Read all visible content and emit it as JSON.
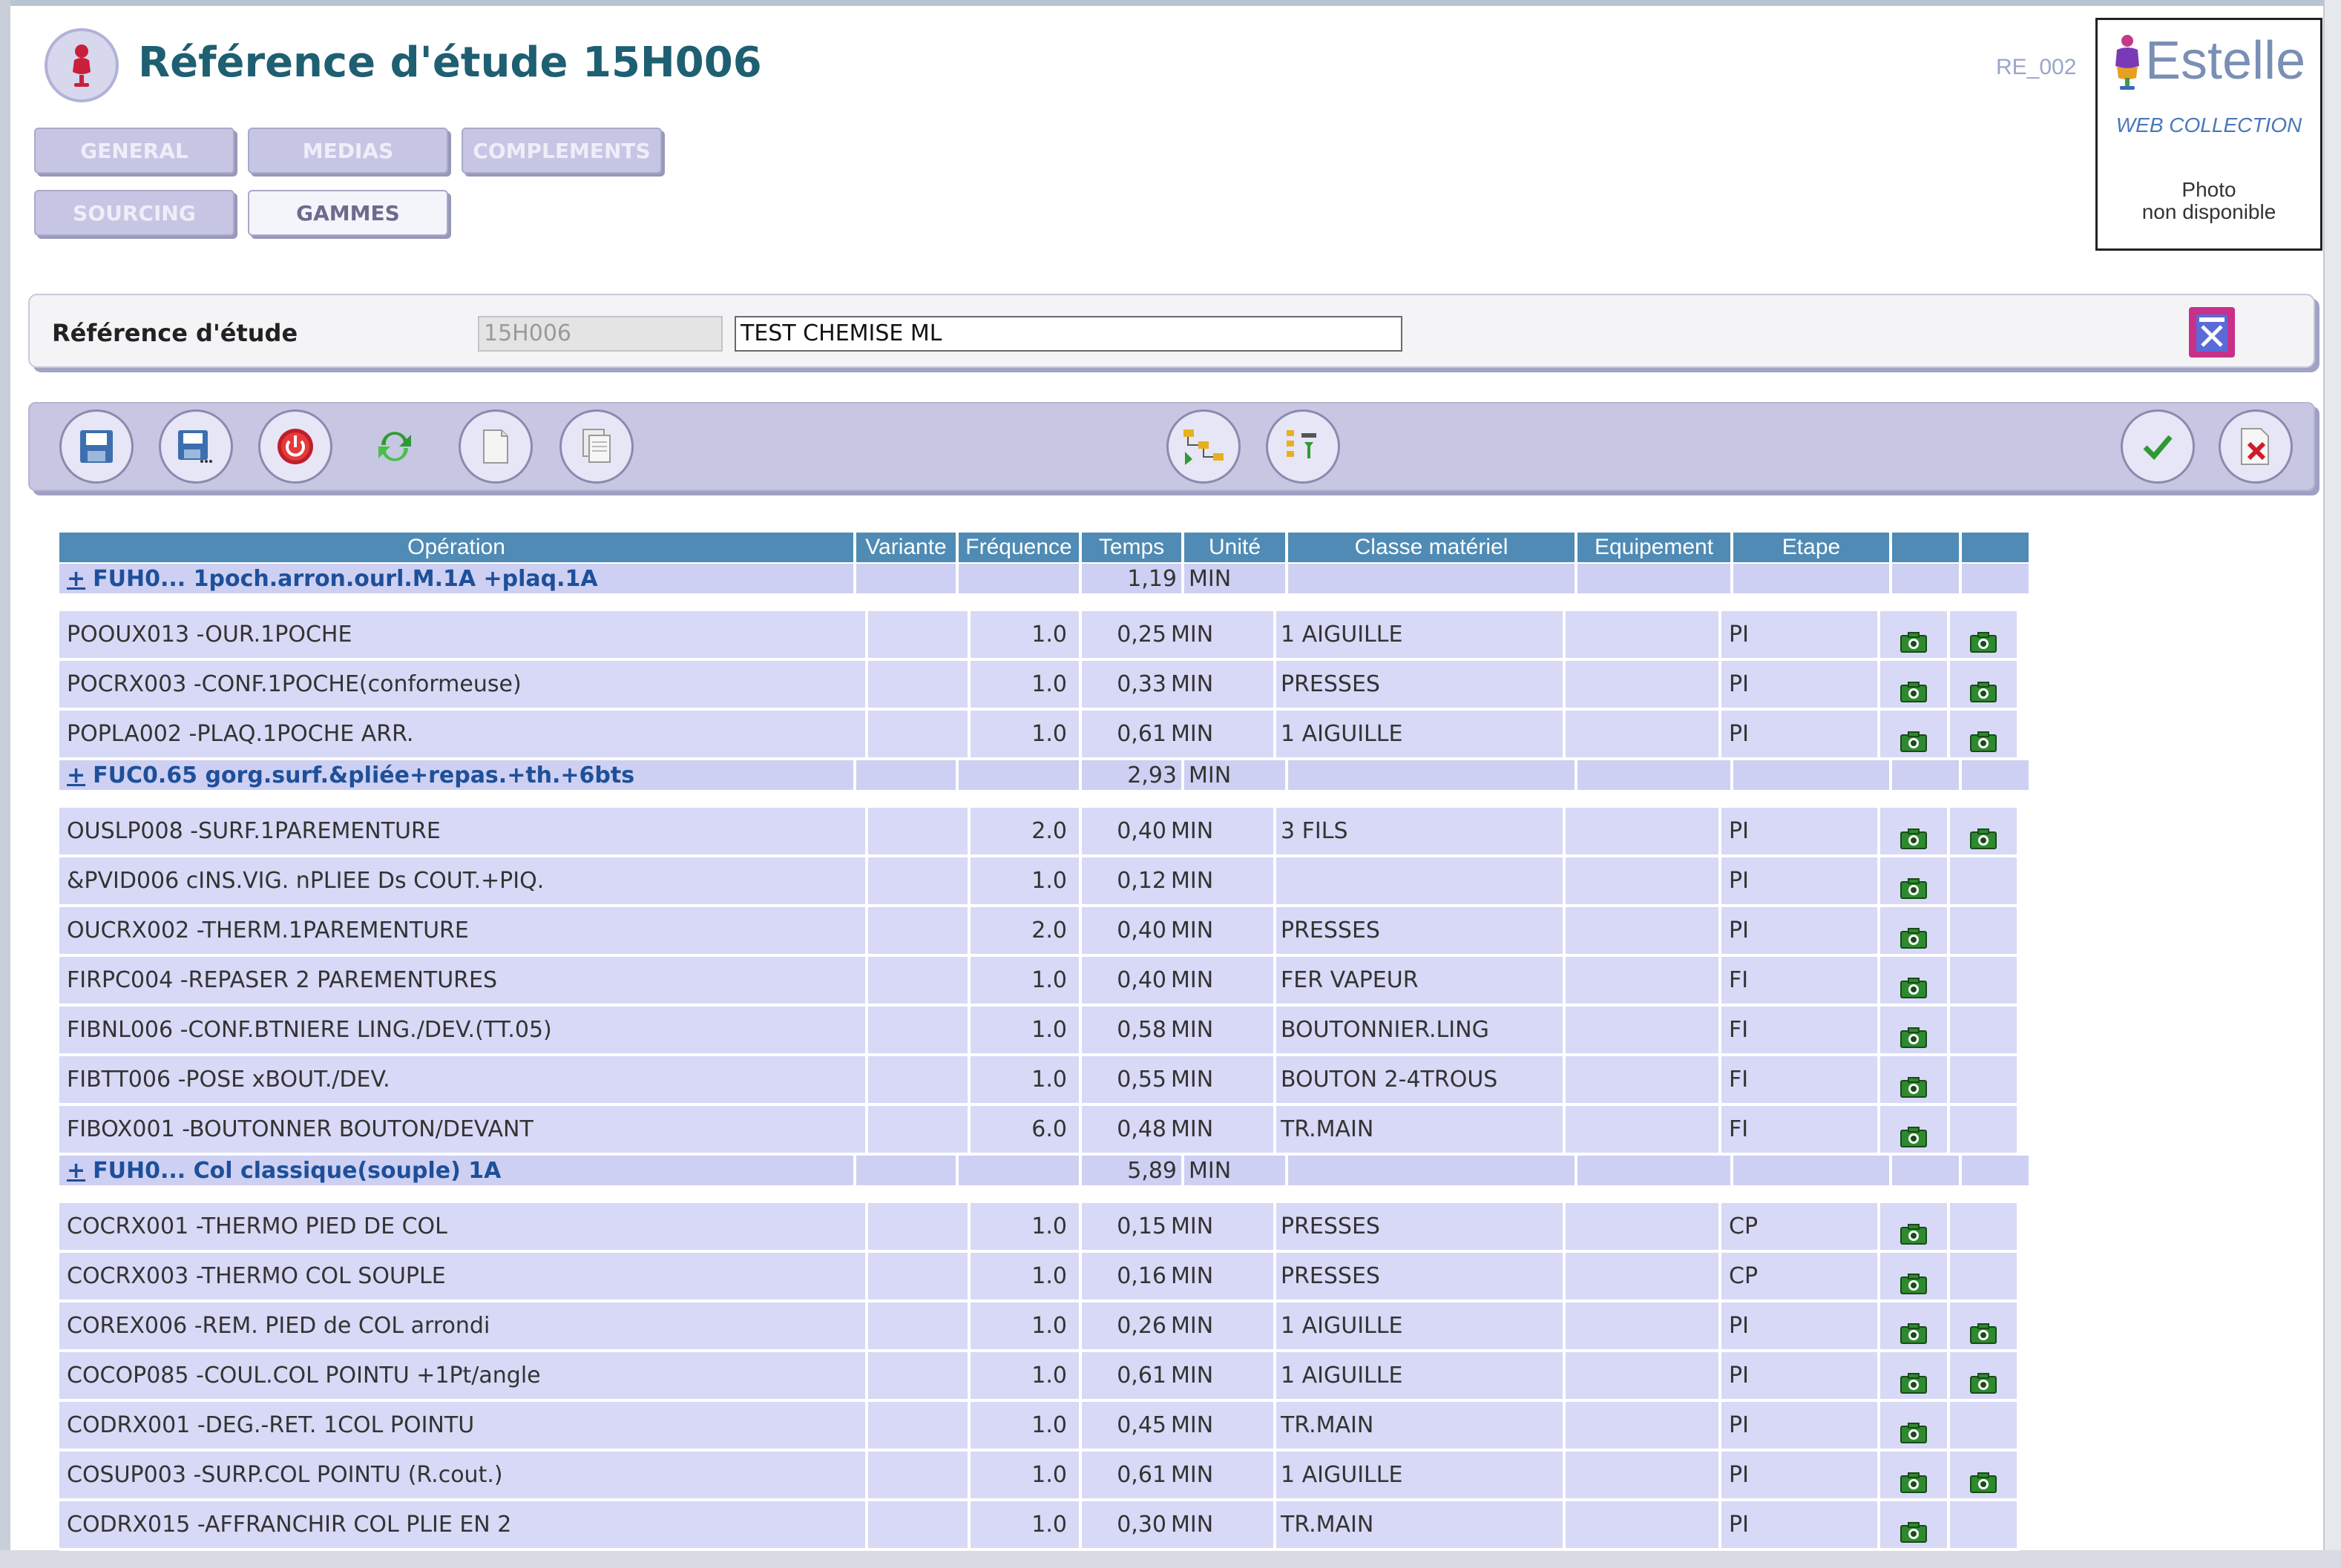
{
  "header": {
    "title": "Référence d'étude 15H006",
    "screen_code": "RE_002"
  },
  "brand": {
    "name": "Estelle",
    "subtitle": "WEB COLLECTION",
    "photo_line1": "Photo",
    "photo_line2": "non disponible"
  },
  "tabs": [
    {
      "label": "GENERAL",
      "active": false
    },
    {
      "label": "MEDIAS",
      "active": false
    },
    {
      "label": "COMPLEMENTS",
      "active": false
    },
    {
      "label": "SOURCING",
      "active": false
    },
    {
      "label": "GAMMES",
      "active": true
    }
  ],
  "reference": {
    "label": "Référence d'étude",
    "code_value": "15H006",
    "name_value": "TEST CHEMISE ML"
  },
  "toolbar": {
    "buttons": [
      "save-icon",
      "save-as-icon",
      "power-icon",
      "refresh-icon",
      "new-page-icon",
      "copy-icon",
      "tree-move-icon",
      "tree-list-icon",
      "validate-icon",
      "cancel-icon"
    ]
  },
  "grid": {
    "columns": [
      "Opération",
      "Variante",
      "Fréquence",
      "Temps",
      "Unité",
      "Classe matériel",
      "Equipement",
      "Etape",
      "",
      ""
    ],
    "rows": [
      {
        "type": "group",
        "expander": "+",
        "label": "FUH0... 1poch.arron.ourl.M.1A +plaq.1A",
        "time": "1,19",
        "unit": "MIN"
      },
      {
        "type": "op",
        "operation": "POOUX013 -OUR.1POCHE",
        "variante": "",
        "frequence": "1.0",
        "time": "0,25",
        "unit": "MIN",
        "classe": "1 AIGUILLE",
        "equipement": "",
        "etape": "PI",
        "cam1": true,
        "cam2": true
      },
      {
        "type": "op",
        "operation": "POCRX003 -CONF.1POCHE(conformeuse)",
        "variante": "",
        "frequence": "1.0",
        "time": "0,33",
        "unit": "MIN",
        "classe": "PRESSES",
        "equipement": "",
        "etape": "PI",
        "cam1": true,
        "cam2": true
      },
      {
        "type": "op",
        "operation": "POPLA002 -PLAQ.1POCHE ARR.",
        "variante": "",
        "frequence": "1.0",
        "time": "0,61",
        "unit": "MIN",
        "classe": "1 AIGUILLE",
        "equipement": "",
        "etape": "PI",
        "cam1": true,
        "cam2": true
      },
      {
        "type": "group",
        "expander": "+",
        "label": "FUC0.65 gorg.surf.&pliée+repas.+th.+6bts",
        "time": "2,93",
        "unit": "MIN"
      },
      {
        "type": "op",
        "operation": "OUSLP008 -SURF.1PAREMENTURE",
        "variante": "",
        "frequence": "2.0",
        "time": "0,40",
        "unit": "MIN",
        "classe": "3 FILS",
        "equipement": "",
        "etape": "PI",
        "cam1": true,
        "cam2": true
      },
      {
        "type": "op",
        "operation": "&PVID006 cINS.VIG. nPLIEE Ds COUT.+PIQ.",
        "variante": "",
        "frequence": "1.0",
        "time": "0,12",
        "unit": "MIN",
        "classe": "",
        "equipement": "",
        "etape": "PI",
        "cam1": true,
        "cam2": false
      },
      {
        "type": "op",
        "operation": "OUCRX002 -THERM.1PAREMENTURE",
        "variante": "",
        "frequence": "2.0",
        "time": "0,40",
        "unit": "MIN",
        "classe": "PRESSES",
        "equipement": "",
        "etape": "PI",
        "cam1": true,
        "cam2": false
      },
      {
        "type": "op",
        "operation": "FIRPC004 -REPASER 2 PAREMENTURES",
        "variante": "",
        "frequence": "1.0",
        "time": "0,40",
        "unit": "MIN",
        "classe": "FER VAPEUR",
        "equipement": "",
        "etape": "FI",
        "cam1": true,
        "cam2": false
      },
      {
        "type": "op",
        "operation": "FIBNL006 -CONF.BTNIERE LING./DEV.(TT.05)",
        "variante": "",
        "frequence": "1.0",
        "time": "0,58",
        "unit": "MIN",
        "classe": "BOUTONNIER.LING",
        "equipement": "",
        "etape": "FI",
        "cam1": true,
        "cam2": false
      },
      {
        "type": "op",
        "operation": "FIBTT006 -POSE xBOUT./DEV.",
        "variante": "",
        "frequence": "1.0",
        "time": "0,55",
        "unit": "MIN",
        "classe": "BOUTON 2-4TROUS",
        "equipement": "",
        "etape": "FI",
        "cam1": true,
        "cam2": false
      },
      {
        "type": "op",
        "operation": "FIBOX001 -BOUTONNER BOUTON/DEVANT",
        "variante": "",
        "frequence": "6.0",
        "time": "0,48",
        "unit": "MIN",
        "classe": "TR.MAIN",
        "equipement": "",
        "etape": "FI",
        "cam1": true,
        "cam2": false
      },
      {
        "type": "group",
        "expander": "+",
        "label": "FUH0... Col classique(souple) 1A",
        "time": "5,89",
        "unit": "MIN"
      },
      {
        "type": "op",
        "operation": "COCRX001 -THERMO PIED DE COL",
        "variante": "",
        "frequence": "1.0",
        "time": "0,15",
        "unit": "MIN",
        "classe": "PRESSES",
        "equipement": "",
        "etape": "CP",
        "cam1": true,
        "cam2": false
      },
      {
        "type": "op",
        "operation": "COCRX003 -THERMO COL SOUPLE",
        "variante": "",
        "frequence": "1.0",
        "time": "0,16",
        "unit": "MIN",
        "classe": "PRESSES",
        "equipement": "",
        "etape": "CP",
        "cam1": true,
        "cam2": false
      },
      {
        "type": "op",
        "operation": "COREX006 -REM. PIED de COL arrondi",
        "variante": "",
        "frequence": "1.0",
        "time": "0,26",
        "unit": "MIN",
        "classe": "1 AIGUILLE",
        "equipement": "",
        "etape": "PI",
        "cam1": true,
        "cam2": true
      },
      {
        "type": "op",
        "operation": "COCOP085 -COUL.COL POINTU +1Pt/angle",
        "variante": "",
        "frequence": "1.0",
        "time": "0,61",
        "unit": "MIN",
        "classe": "1 AIGUILLE",
        "equipement": "",
        "etape": "PI",
        "cam1": true,
        "cam2": true
      },
      {
        "type": "op",
        "operation": "CODRX001 -DEG.-RET. 1COL POINTU",
        "variante": "",
        "frequence": "1.0",
        "time": "0,45",
        "unit": "MIN",
        "classe": "TR.MAIN",
        "equipement": "",
        "etape": "PI",
        "cam1": true,
        "cam2": false
      },
      {
        "type": "op",
        "operation": "COSUP003 -SURP.COL POINTU (R.cout.)",
        "variante": "",
        "frequence": "1.0",
        "time": "0,61",
        "unit": "MIN",
        "classe": "1 AIGUILLE",
        "equipement": "",
        "etape": "PI",
        "cam1": true,
        "cam2": true
      },
      {
        "type": "op",
        "operation": "CODRX015 -AFFRANCHIR COL PLIE EN 2",
        "variante": "",
        "frequence": "1.0",
        "time": "0,30",
        "unit": "MIN",
        "classe": "TR.MAIN",
        "equipement": "",
        "etape": "PI",
        "cam1": true,
        "cam2": false
      }
    ]
  },
  "colors": {
    "title": "#1e5f72",
    "header_bg": "#4f8bb4",
    "row_bg": "#d7d9f6",
    "group_text": "#1e4f9a",
    "tab_bg": "#c6c6e4"
  }
}
